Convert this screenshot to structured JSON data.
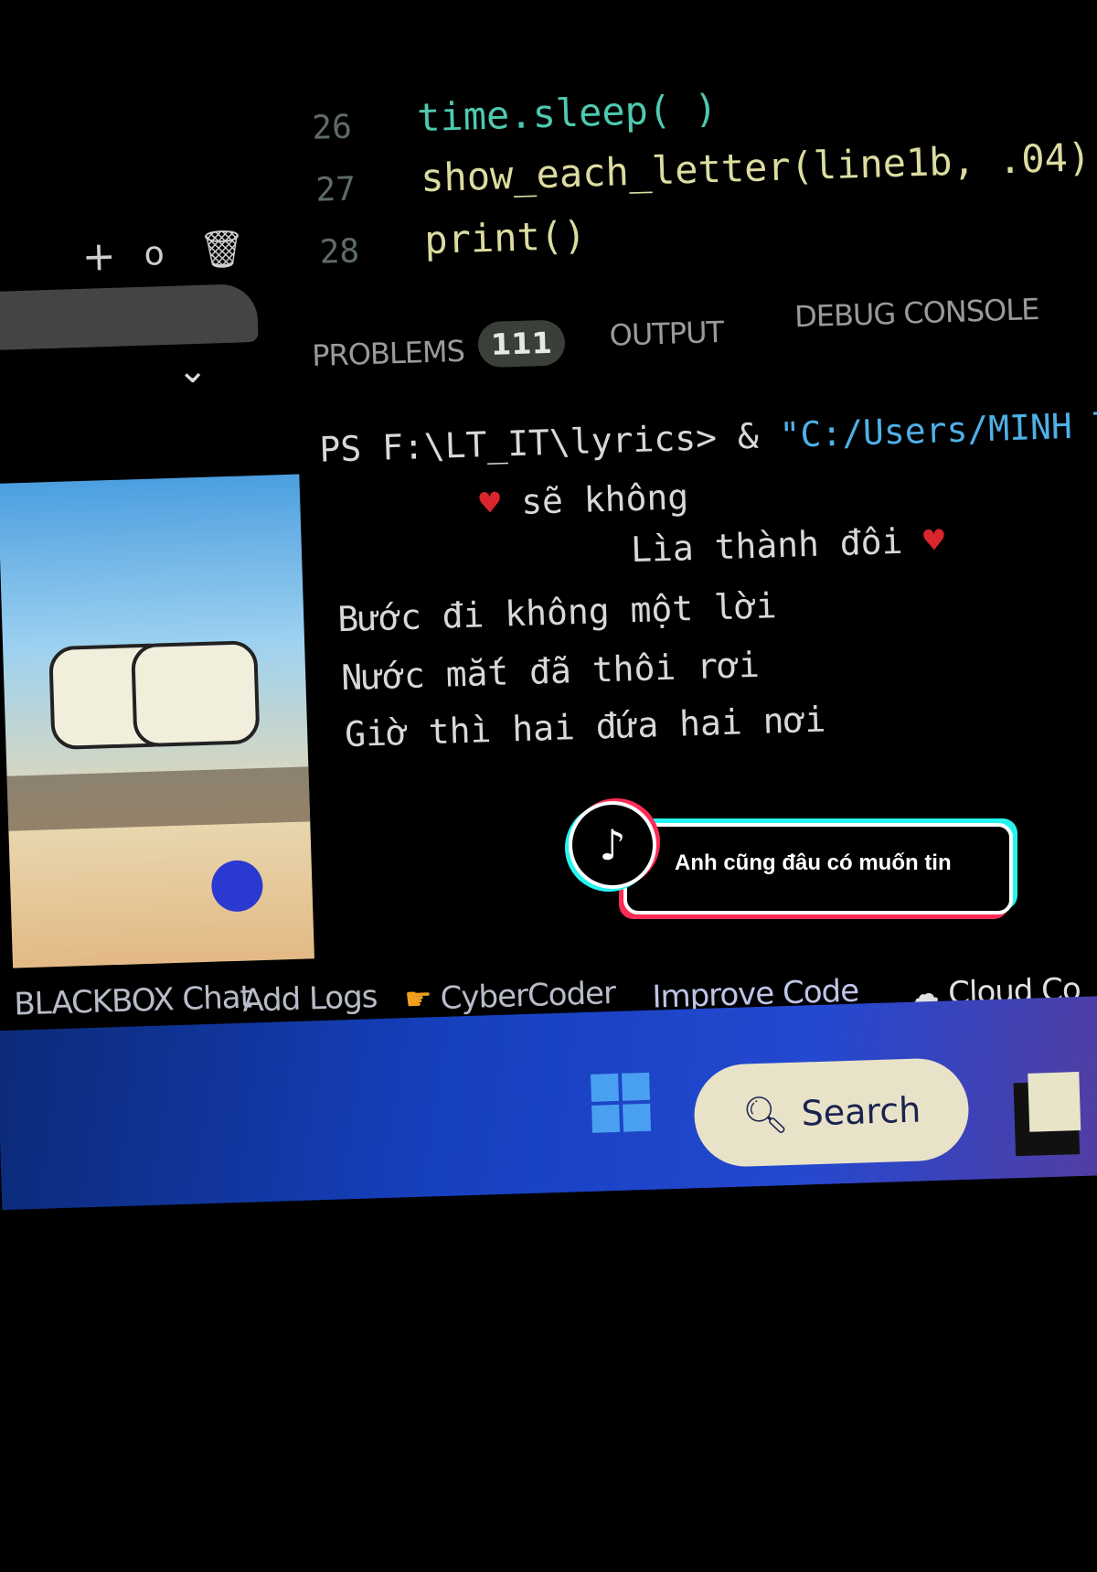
{
  "editor": {
    "lines": [
      {
        "num": "26",
        "code": "time.sleep( )"
      },
      {
        "num": "27",
        "code": "show_each_letter(line1b, .04)"
      },
      {
        "num": "28",
        "code": "print()"
      }
    ]
  },
  "sidebar": {
    "icons": [
      "plus-icon",
      "circle-icon",
      "trash-icon"
    ]
  },
  "panel_tabs": {
    "problems": "PROBLEMS",
    "problems_count": "111",
    "output": "OUTPUT",
    "debug_console": "DEBUG CONSOLE"
  },
  "terminal": {
    "prompt": "PS F:\\LT_IT\\lyrics> & ",
    "command": "\"C:/Users/MINH T",
    "lines": [
      "sẽ không",
      "Lìa thành đôi",
      "Bước đi không một lời",
      "Nước mắt đã thôi rơi",
      "Giờ thì hai đứa hai nơi"
    ]
  },
  "status_toolbar": {
    "items": [
      "BLACKBOX Chat",
      "Add Logs",
      "CyberCoder",
      "Improve Code",
      "Cloud Co"
    ]
  },
  "taskbar": {
    "search_label": "Search"
  },
  "overlay": {
    "caption": "Anh cũng đâu có muốn tin",
    "brand_colors": {
      "cyan": "#25f4ee",
      "red": "#fe2c55"
    }
  },
  "colors": {
    "code_fn": "#dcdca0",
    "code_var": "#9cdcfe",
    "bracket": "#ffd700",
    "string": "#4fb0e8",
    "heart": "#d9252c"
  }
}
